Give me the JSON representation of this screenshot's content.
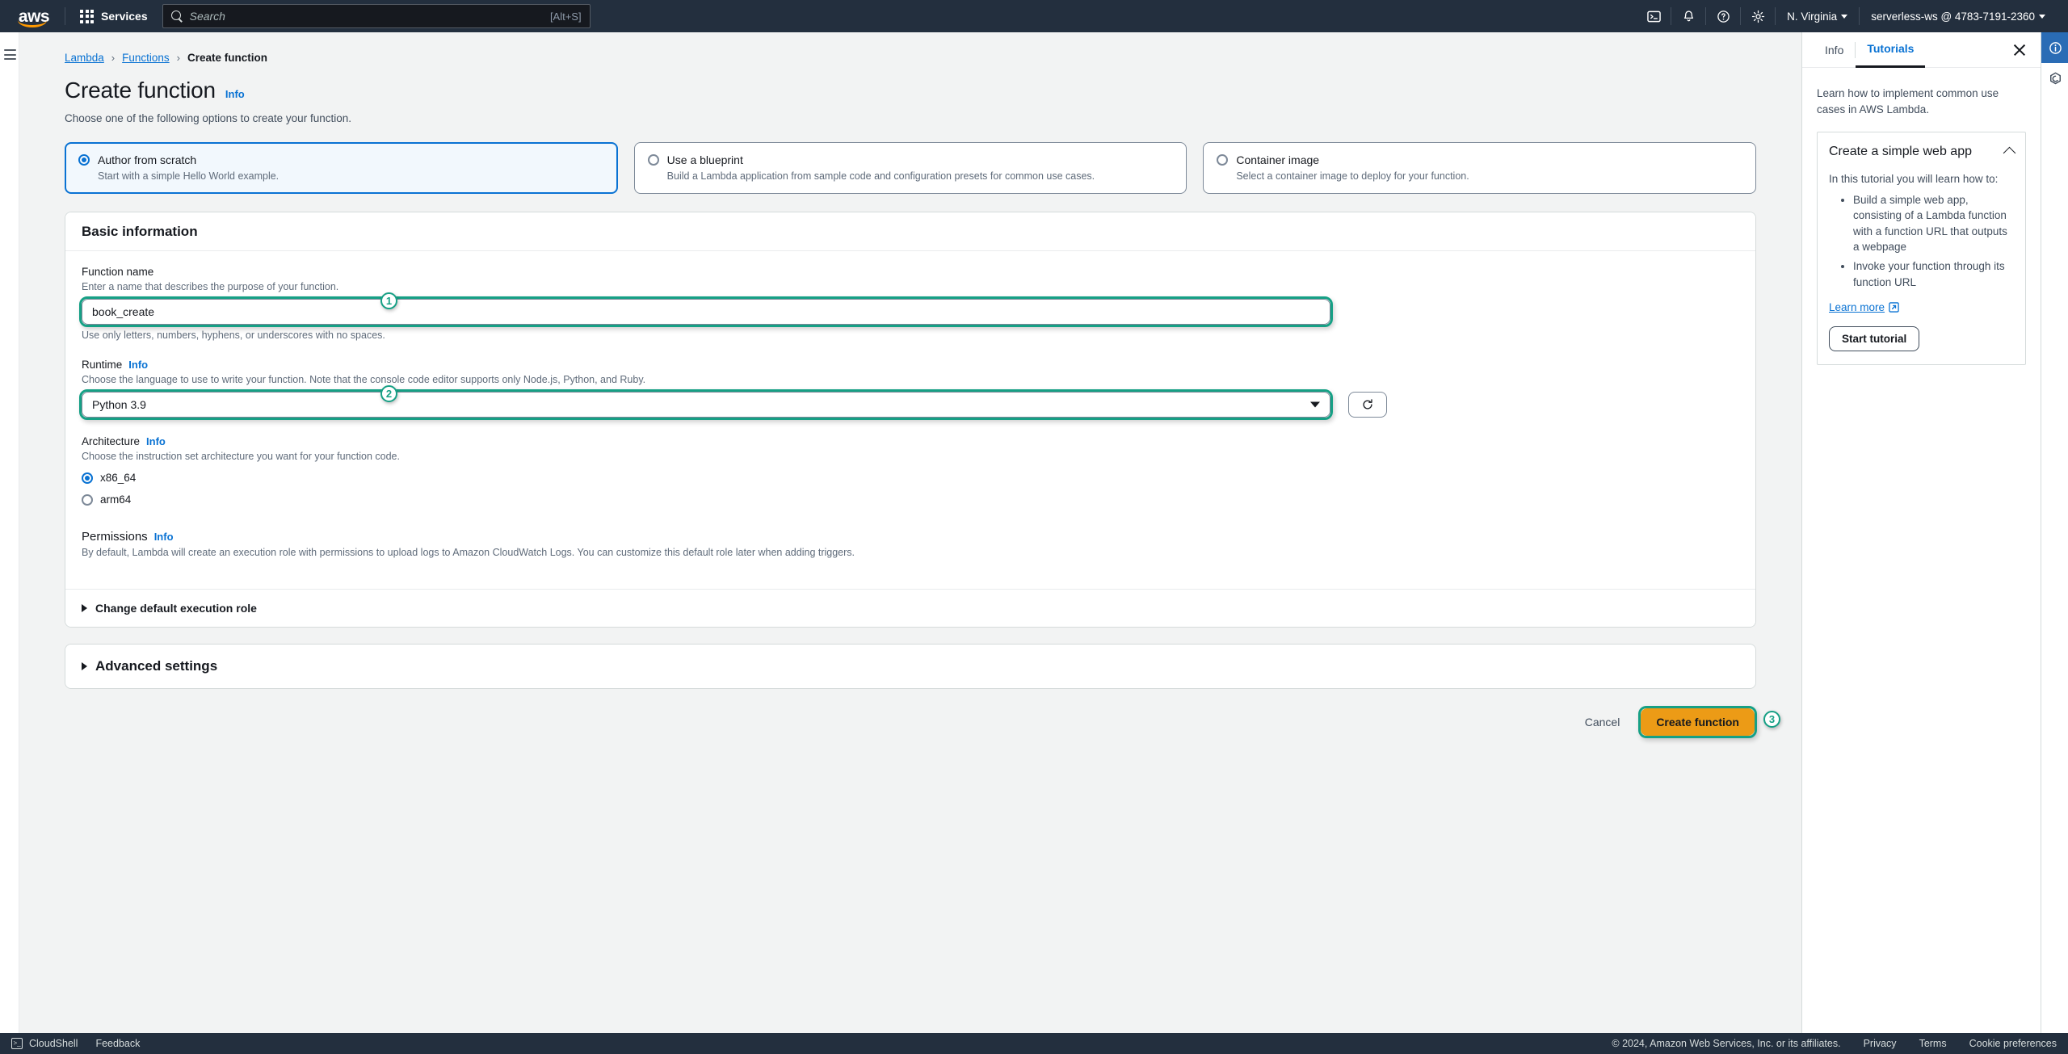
{
  "topnav": {
    "logo_text": "aws",
    "services_label": "Services",
    "search_placeholder": "Search",
    "search_shortcut": "[Alt+S]",
    "cloudshell_icon": "cloudshell-icon",
    "bell_icon": "bell-icon",
    "help_icon": "help-circle-icon",
    "settings_icon": "gear-icon",
    "region": "N. Virginia",
    "account": "serverless-ws @ 4783-7191-2360"
  },
  "breadcrumb": {
    "items": [
      {
        "label": "Lambda",
        "link": true
      },
      {
        "label": "Functions",
        "link": true
      },
      {
        "label": "Create function",
        "link": false
      }
    ],
    "separator": "›"
  },
  "page": {
    "title": "Create function",
    "info_label": "Info",
    "description": "Choose one of the following options to create your function."
  },
  "options": [
    {
      "label": "Author from scratch",
      "sublabel": "Start with a simple Hello World example.",
      "selected": true
    },
    {
      "label": "Use a blueprint",
      "sublabel": "Build a Lambda application from sample code and configuration presets for common use cases.",
      "selected": false
    },
    {
      "label": "Container image",
      "sublabel": "Select a container image to deploy for your function.",
      "selected": false
    }
  ],
  "basic_information": {
    "section_title": "Basic information",
    "function_name": {
      "label": "Function name",
      "description": "Enter a name that describes the purpose of your function.",
      "value": "book_create",
      "placeholder": "",
      "hint": "Use only letters, numbers, hyphens, or underscores with no spaces.",
      "badge": "1"
    },
    "runtime": {
      "label": "Runtime",
      "info_label": "Info",
      "description": "Choose the language to use to write your function. Note that the console code editor supports only Node.js, Python, and Ruby.",
      "value": "Python 3.9",
      "badge": "2",
      "refresh_icon": "refresh-icon"
    },
    "architecture": {
      "label": "Architecture",
      "info_label": "Info",
      "description": "Choose the instruction set architecture you want for your function code.",
      "options": [
        {
          "label": "x86_64",
          "selected": true
        },
        {
          "label": "arm64",
          "selected": false
        }
      ]
    },
    "permissions": {
      "label": "Permissions",
      "info_label": "Info",
      "description": "By default, Lambda will create an execution role with permissions to upload logs to Amazon CloudWatch Logs. You can customize this default role later when adding triggers."
    },
    "change_role_label": "Change default execution role"
  },
  "advanced_settings_label": "Advanced settings",
  "actions": {
    "cancel_label": "Cancel",
    "create_label": "Create function",
    "create_badge": "3"
  },
  "right_panel": {
    "tabs": [
      {
        "label": "Info",
        "active": false
      },
      {
        "label": "Tutorials",
        "active": true
      }
    ],
    "close_icon": "close-icon",
    "intro": "Learn how to implement common use cases in AWS Lambda.",
    "tutorial": {
      "title": "Create a simple web app",
      "collapse_icon": "chevron-up-icon",
      "intro": "In this tutorial you will learn how to:",
      "bullets": [
        "Build a simple web app, consisting of a Lambda function with a function URL that outputs a webpage",
        "Invoke your function through its function URL"
      ],
      "learn_more_label": "Learn more",
      "external_icon": "external-link-icon",
      "start_label": "Start tutorial"
    }
  },
  "icon_rail": {
    "info_icon": "info-circle-icon",
    "hexagon_icon": "hexagon-icon"
  },
  "footer": {
    "cloudshell_label": "CloudShell",
    "feedback_label": "Feedback",
    "copyright": "© 2024, Amazon Web Services, Inc. or its affiliates.",
    "links": [
      "Privacy",
      "Terms",
      "Cookie preferences"
    ]
  },
  "colors": {
    "nav_bg": "#232f3e",
    "accent_blue": "#0972d3",
    "highlight_green": "#16a085",
    "primary_orange": "#ec9b16"
  }
}
